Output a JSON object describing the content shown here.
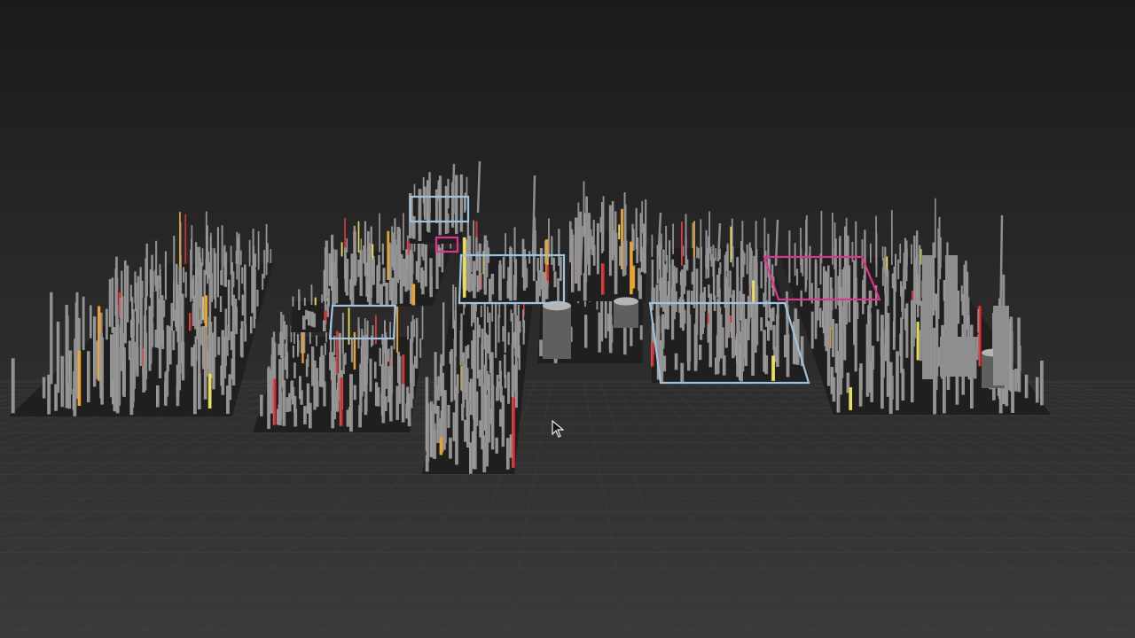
{
  "scene": {
    "title": "",
    "colors": {
      "background_top": "#1b1b1b",
      "background_bottom": "#3a3a3a",
      "grid_line": "#4a4a4a",
      "base_plate": "#1f1f1f",
      "pillar": "#8e8e8e",
      "pillar_highlight": "#b5b5b5",
      "pillar_shadow": "#5f5f5f",
      "alert_red": "#d8262a",
      "warn_orange": "#f0a020",
      "note_yellow": "#f2e24a",
      "group_outline_blue": "#9fc3df",
      "group_outline_magenta": "#e0328f"
    },
    "icons": {
      "pointer": "mouse-pointer-icon"
    }
  }
}
